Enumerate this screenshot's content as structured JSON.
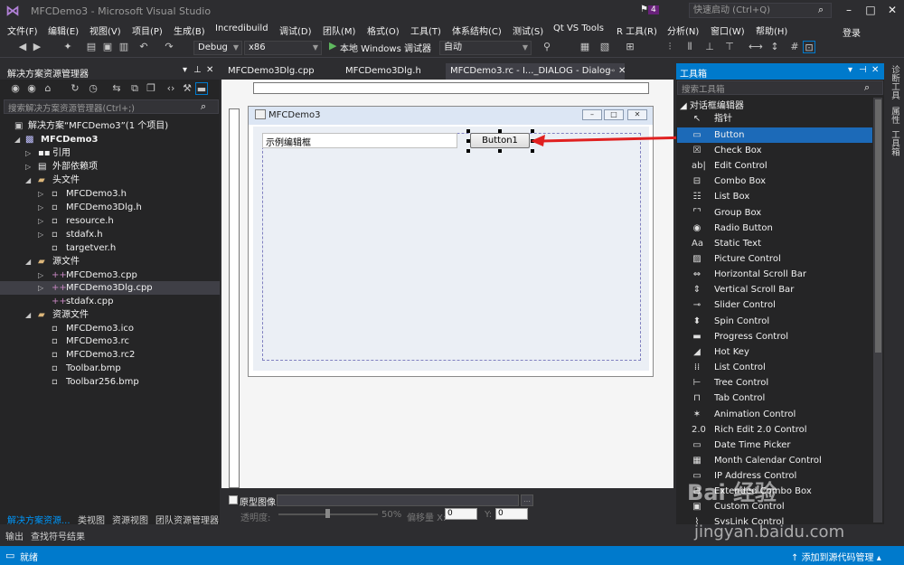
{
  "window": {
    "title": "MFCDemo3 - Microsoft Visual Studio",
    "notifications": "4",
    "quick_launch": "快速启动 (Ctrl+Q)",
    "login": "登录"
  },
  "menu": [
    "文件(F)",
    "编辑(E)",
    "视图(V)",
    "项目(P)",
    "生成(B)",
    "Incredibuild",
    "调试(D)",
    "团队(M)",
    "格式(O)",
    "工具(T)",
    "体系结构(C)",
    "测试(S)",
    "Qt VS Tools",
    "R 工具(R)",
    "分析(N)",
    "窗口(W)",
    "帮助(H)"
  ],
  "toolbar": {
    "config": "Debug",
    "platform": "x86",
    "run_label": "本地 Windows 调试器",
    "run_mode": "自动"
  },
  "solution": {
    "header": "解决方案资源管理器",
    "search_placeholder": "搜索解决方案资源管理器(Ctrl+;)",
    "items": [
      {
        "label": "解决方案“MFCDemo3”(1 个项目)"
      },
      {
        "label": "MFCDemo3"
      },
      {
        "label": "引用"
      },
      {
        "label": "外部依赖项"
      },
      {
        "label": "头文件"
      },
      {
        "label": "MFCDemo3.h"
      },
      {
        "label": "MFCDemo3Dlg.h"
      },
      {
        "label": "resource.h"
      },
      {
        "label": "stdafx.h"
      },
      {
        "label": "targetver.h"
      },
      {
        "label": "源文件"
      },
      {
        "label": "MFCDemo3.cpp"
      },
      {
        "label": "MFCDemo3Dlg.cpp"
      },
      {
        "label": "stdafx.cpp"
      },
      {
        "label": "资源文件"
      },
      {
        "label": "MFCDemo3.ico"
      },
      {
        "label": "MFCDemo3.rc"
      },
      {
        "label": "MFCDemo3.rc2"
      },
      {
        "label": "Toolbar.bmp"
      },
      {
        "label": "Toolbar256.bmp"
      }
    ],
    "tabs": [
      "解决方案资源...",
      "类视图",
      "资源视图",
      "团队资源管理器"
    ]
  },
  "doc_tabs": [
    "MFCDemo3Dlg.cpp",
    "MFCDemo3Dlg.h",
    "MFCDemo3.rc - I..._DIALOG - Dialog"
  ],
  "dialog": {
    "title": "MFCDemo3",
    "edit_text": "示例编辑框",
    "button_text": "Button1"
  },
  "prototype": {
    "label": "原型图像:",
    "opacity_label": "透明度:",
    "opacity_value": "50%",
    "offset_label": "偏移量 X:",
    "x_value": "0",
    "y_label": "Y:",
    "y_value": "0"
  },
  "toolbox": {
    "header": "工具箱",
    "search_placeholder": "搜索工具箱",
    "group": "对话框编辑器",
    "items": [
      {
        "label": "指针",
        "icon": "pointer-icon"
      },
      {
        "label": "Button",
        "icon": "button-icon"
      },
      {
        "label": "Check Box",
        "icon": "checkbox-icon"
      },
      {
        "label": "Edit Control",
        "icon": "edit-icon"
      },
      {
        "label": "Combo Box",
        "icon": "combo-icon"
      },
      {
        "label": "List Box",
        "icon": "listbox-icon"
      },
      {
        "label": "Group Box",
        "icon": "groupbox-icon"
      },
      {
        "label": "Radio Button",
        "icon": "radio-icon"
      },
      {
        "label": "Static Text",
        "icon": "static-text-icon"
      },
      {
        "label": "Picture Control",
        "icon": "picture-icon"
      },
      {
        "label": "Horizontal Scroll Bar",
        "icon": "hscroll-icon"
      },
      {
        "label": "Vertical Scroll Bar",
        "icon": "vscroll-icon"
      },
      {
        "label": "Slider Control",
        "icon": "slider-icon"
      },
      {
        "label": "Spin Control",
        "icon": "spin-icon"
      },
      {
        "label": "Progress Control",
        "icon": "progress-icon"
      },
      {
        "label": "Hot Key",
        "icon": "hotkey-icon"
      },
      {
        "label": "List Control",
        "icon": "listctrl-icon"
      },
      {
        "label": "Tree Control",
        "icon": "tree-icon"
      },
      {
        "label": "Tab Control",
        "icon": "tab-icon"
      },
      {
        "label": "Animation Control",
        "icon": "animation-icon"
      },
      {
        "label": "Rich Edit 2.0 Control",
        "icon": "richedit-icon"
      },
      {
        "label": "Date Time Picker",
        "icon": "datetime-icon"
      },
      {
        "label": "Month Calendar Control",
        "icon": "calendar-icon"
      },
      {
        "label": "IP Address Control",
        "icon": "ip-icon"
      },
      {
        "label": "Extended Combo Box",
        "icon": "extcombo-icon"
      },
      {
        "label": "Custom Control",
        "icon": "custom-icon"
      },
      {
        "label": "SysLink Control",
        "icon": "syslink-icon"
      }
    ]
  },
  "side_tabs": [
    "诊断工具",
    "属性",
    "工具箱"
  ],
  "output_tabs": [
    "输出",
    "查找符号结果"
  ],
  "status": {
    "text": "就绪",
    "source_control": "添加到源代码管理"
  },
  "watermark": {
    "brand": "Bai 经验",
    "url": "jingyan.baidu.com"
  },
  "colors": {
    "accent": "#007acc",
    "selection": "#1c6ab8",
    "arrow": "#e02020"
  }
}
